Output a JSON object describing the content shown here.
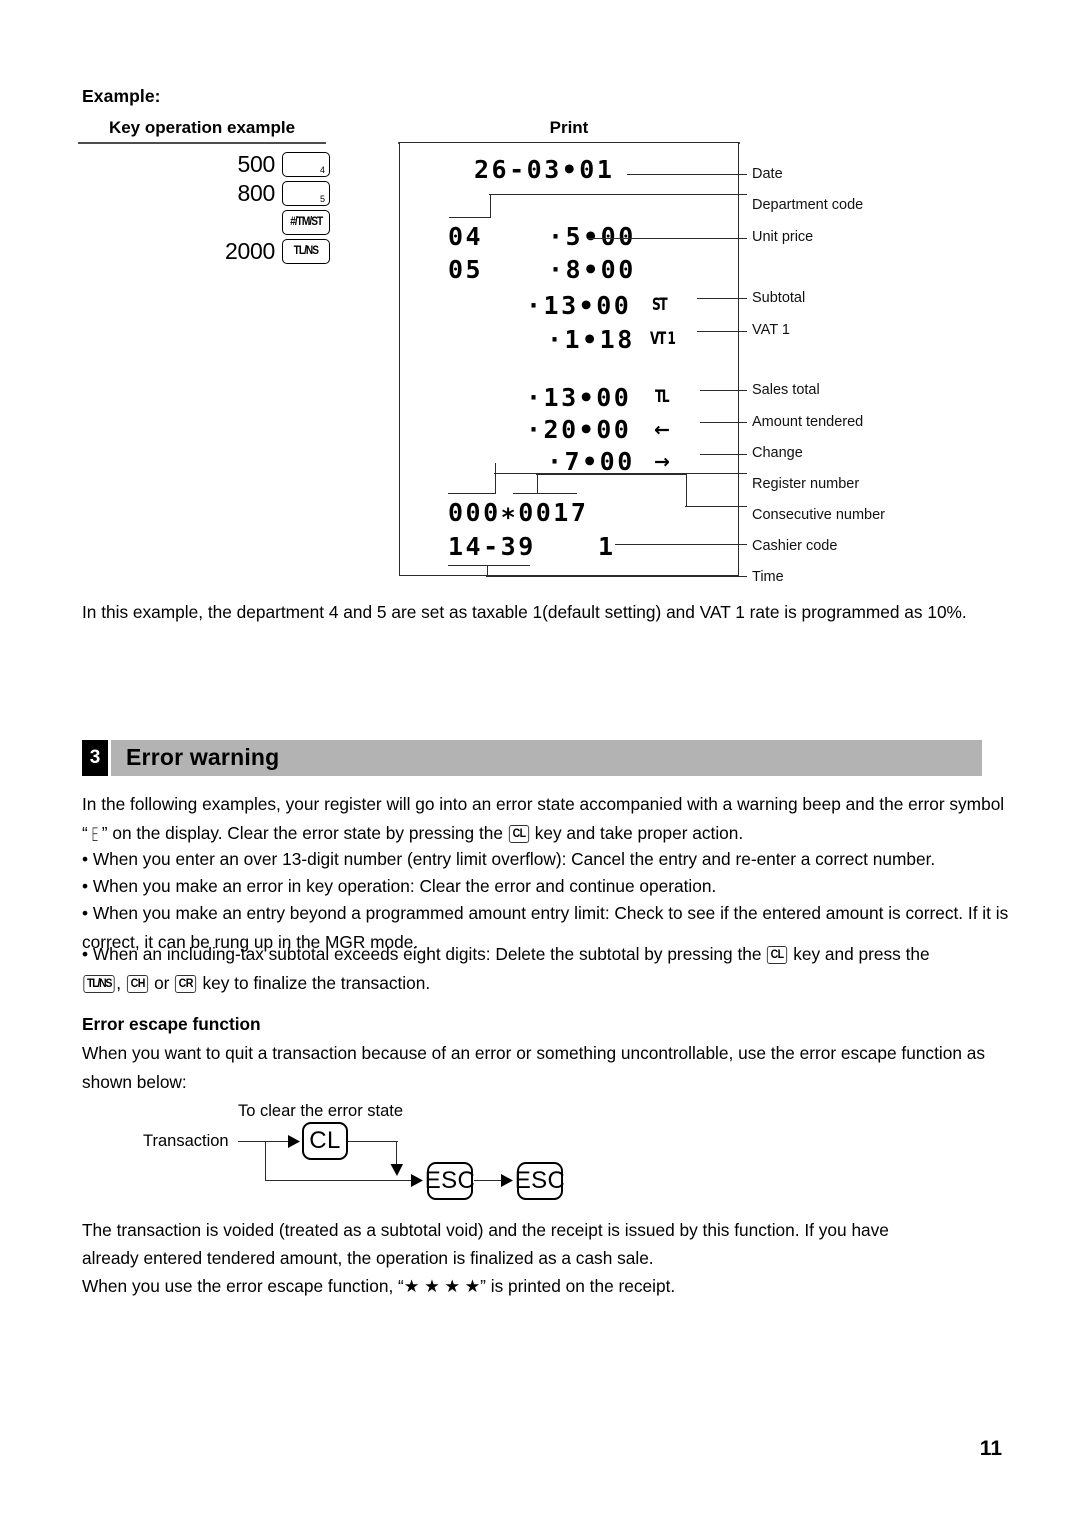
{
  "example": {
    "label": "Example:",
    "columns": {
      "key_operation": "Key operation example",
      "print": "Print"
    },
    "key_operations": [
      {
        "amount": "500",
        "key": "",
        "sub": "4",
        "type": "dept"
      },
      {
        "amount": "800",
        "key": "",
        "sub": "5",
        "type": "dept"
      },
      {
        "amount": "",
        "key": "#/TM/ST",
        "sub": "",
        "type": "func"
      },
      {
        "amount": "2000",
        "key": "TL/NS",
        "sub": "",
        "type": "func"
      }
    ]
  },
  "receipt": {
    "lines": [
      {
        "id": "date",
        "text": "26-03•01"
      },
      {
        "id": "dept4",
        "code": "04",
        "amount": "⋅5•00"
      },
      {
        "id": "dept5",
        "code": "05",
        "amount": "⋅8•00"
      },
      {
        "id": "subtotal",
        "amount": "⋅13•00",
        "mark": "ST"
      },
      {
        "id": "vat1",
        "amount": "⋅1•18",
        "mark": "VT 1"
      },
      {
        "id": "sales_total",
        "amount": "⋅13•00",
        "mark": "TL"
      },
      {
        "id": "tendered",
        "amount": "⋅20•00",
        "mark": "←"
      },
      {
        "id": "change",
        "amount": "⋅7•00",
        "mark": "→"
      },
      {
        "id": "regcons",
        "text": "000∗0017"
      },
      {
        "id": "timecashier",
        "time": "14-39",
        "cashier": "1"
      }
    ],
    "annotations": [
      "Date",
      "Department code",
      "Unit price",
      "Subtotal",
      "VAT 1",
      "Sales total",
      "Amount tendered",
      "Change",
      "Register number",
      "Consecutive number",
      "Cashier code",
      "Time"
    ]
  },
  "note": "In this example, the department 4 and 5 are set as taxable 1(default setting) and VAT 1 rate is programmed as 10%.",
  "section": {
    "number": "3",
    "title": "Error warning",
    "bar_color": "#b3b3b3"
  },
  "intro": {
    "part1": "In the following examples, your register will go into an error state accompanied with a warning beep and the error symbol “",
    "symbol": "E",
    "part2": "” on the display.  Clear the error state by pressing the ",
    "chip": "CL",
    "part3": " key and take proper action."
  },
  "bullets": [
    {
      "text": "When you enter an over 13-digit number (entry limit overflow): Cancel the entry and re-enter a correct number."
    },
    {
      "text": "When you make an error in key operation: Clear the error and continue operation."
    },
    {
      "text": "When you make an entry beyond a programmed amount entry limit: Check to see if the entered amount is correct.  If it is correct, it can be rung up in the MGR mode."
    },
    {
      "pre": "When an including-tax subtotal exceeds eight digits: Delete the subtotal by pressing the ",
      "chip1": "CL",
      "mid": " key and press the ",
      "chip2": "TL/NS",
      "sep": ", ",
      "chip3": "CH",
      "sep2": " or ",
      "chip4": "CR",
      "post": " key to finalize the transaction."
    }
  ],
  "escape": {
    "heading": "Error escape function",
    "paragraph": "When you want to quit a transaction because of an error or something uncontrollable, use the error escape function as shown below:",
    "diagram": {
      "caption": "To clear the error state",
      "start_label": "Transaction",
      "cl_key": "CL",
      "esc_key_1": "ESC",
      "esc_key_2": "ESC"
    }
  },
  "closing": {
    "line1": "The transaction is voided (treated as a subtotal void) and the receipt is issued by this function.  If you have",
    "line2": "already entered tendered amount, the operation is finalized as a cash sale.",
    "line3_pre": "When you use the error escape function, “",
    "line3_stars": "★ ★ ★ ★",
    "line3_post": "” is printed on the receipt."
  },
  "page_number": "11"
}
